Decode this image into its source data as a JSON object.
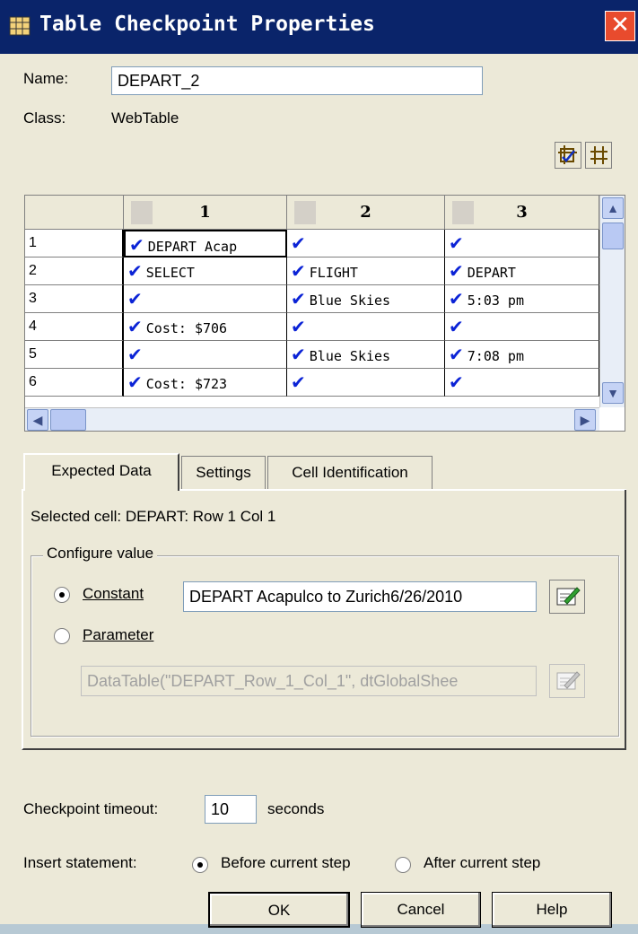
{
  "window": {
    "title": "Table Checkpoint Properties",
    "close_icon": "close-icon"
  },
  "name_label": "Name:",
  "name_value": "DEPART_2",
  "class_label": "Class:",
  "class_value": "WebTable",
  "grid": {
    "columns": [
      "1",
      "2",
      "3"
    ],
    "rows": [
      {
        "num": "1",
        "cells": [
          "DEPART Acap",
          "",
          ""
        ]
      },
      {
        "num": "2",
        "cells": [
          "SELECT",
          "FLIGHT",
          "DEPART"
        ]
      },
      {
        "num": "3",
        "cells": [
          "",
          "Blue Skies",
          "5:03 pm"
        ]
      },
      {
        "num": "4",
        "cells": [
          "Cost: $706",
          "",
          ""
        ]
      },
      {
        "num": "5",
        "cells": [
          "",
          "Blue Skies",
          "7:08 pm"
        ]
      },
      {
        "num": "6",
        "cells": [
          "Cost: $723",
          "",
          ""
        ]
      }
    ]
  },
  "tabs": [
    {
      "label": "Expected Data",
      "active": true
    },
    {
      "label": "Settings",
      "active": false
    },
    {
      "label": "Cell Identification",
      "active": false
    }
  ],
  "selected_cell": "Selected cell: DEPART: Row 1 Col 1",
  "configure": {
    "group_title": "Configure value",
    "constant_label": "Constant",
    "constant_value": "DEPART Acapulco to Zurich6/26/2010",
    "parameter_label": "Parameter",
    "parameter_value": "DataTable(\"DEPART_Row_1_Col_1\", dtGlobalShee",
    "selected": "constant"
  },
  "timeout": {
    "label": "Checkpoint timeout:",
    "value": "10",
    "unit": "seconds"
  },
  "insert": {
    "label": "Insert statement:",
    "before": "Before current step",
    "after": "After current step",
    "selected": "before"
  },
  "buttons": {
    "ok": "OK",
    "cancel": "Cancel",
    "help": "Help"
  },
  "colors": {
    "titlebar": "#0a246a",
    "check": "#0b23d6",
    "close": "#e84b2d"
  }
}
